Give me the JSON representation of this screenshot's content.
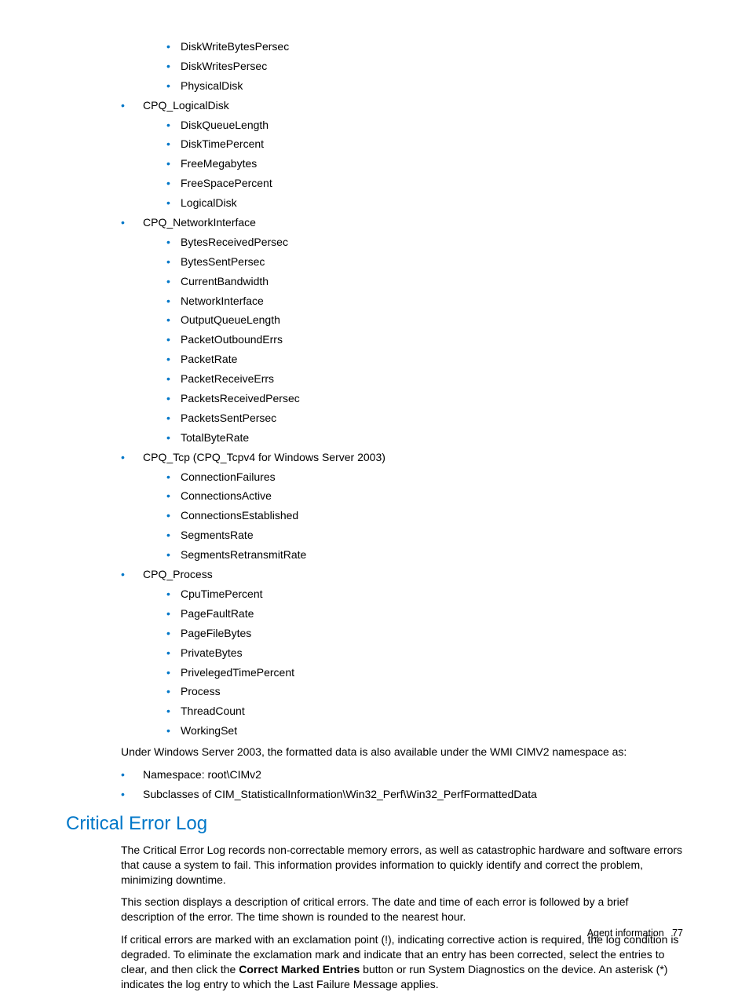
{
  "lists": {
    "continued_sub": [
      "DiskWriteBytesPersec",
      "DiskWritesPersec",
      "PhysicalDisk"
    ],
    "groups": [
      {
        "label": "CPQ_LogicalDisk",
        "items": [
          "DiskQueueLength",
          "DiskTimePercent",
          "FreeMegabytes",
          "FreeSpacePercent",
          "LogicalDisk"
        ]
      },
      {
        "label": "CPQ_NetworkInterface",
        "items": [
          "BytesReceivedPersec",
          "BytesSentPersec",
          "CurrentBandwidth",
          "NetworkInterface",
          "OutputQueueLength",
          "PacketOutboundErrs",
          "PacketRate",
          "PacketReceiveErrs",
          "PacketsReceivedPersec",
          "PacketsSentPersec",
          "TotalByteRate"
        ]
      },
      {
        "label": "CPQ_Tcp (CPQ_Tcpv4 for Windows Server 2003)",
        "items": [
          "ConnectionFailures",
          "ConnectionsActive",
          "ConnectionsEstablished",
          "SegmentsRate",
          "SegmentsRetransmitRate"
        ]
      },
      {
        "label": "CPQ_Process",
        "items": [
          "CpuTimePercent",
          "PageFaultRate",
          "PageFileBytes",
          "PrivateBytes",
          "PrivelegedTimePercent",
          "Process",
          "ThreadCount",
          "WorkingSet"
        ]
      }
    ],
    "namespace_para": "Under Windows Server 2003, the formatted data is also available under the WMI CIMV2 namespace as:",
    "namespace_items": [
      "Namespace: root\\CIMv2",
      "Subclasses of CIM_StatisticalInformation\\Win32_Perf\\Win32_PerfFormattedData"
    ]
  },
  "section": {
    "heading": "Critical Error Log",
    "p1": "The Critical Error Log records non-correctable memory errors, as well as catastrophic hardware and software errors that cause a system to fail. This information provides information to quickly identify and correct the problem, minimizing downtime.",
    "p2": "This section displays a description of critical errors. The date and time of each error is followed by a brief description of the error. The time shown is rounded to the nearest hour.",
    "p3_a": "If critical errors are marked with an exclamation point (!), indicating corrective action is required, the log condition is degraded. To eliminate the exclamation mark and indicate that an entry has been corrected, select the entries to clear, and then click the ",
    "p3_bold": "Correct Marked Entries",
    "p3_b": " button or run System Diagnostics on the device. An asterisk (*) indicates the log entry to which the Last Failure Message applies."
  },
  "footer": {
    "label": "Agent information",
    "page": "77"
  }
}
